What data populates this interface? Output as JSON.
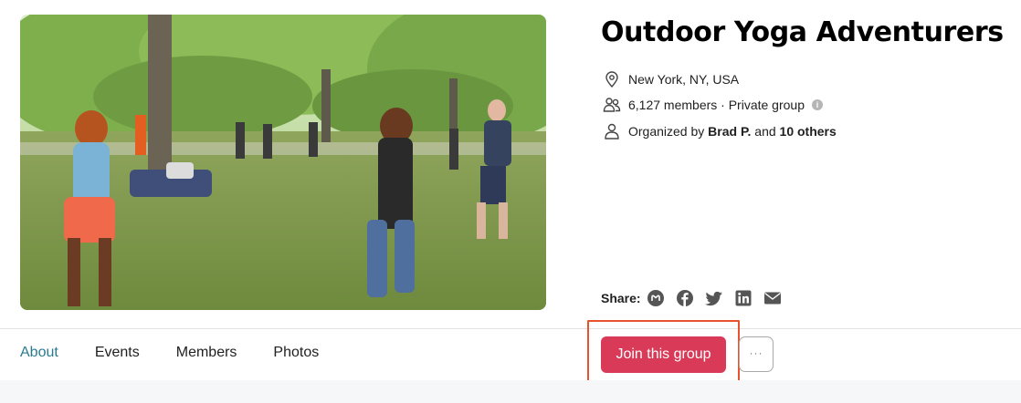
{
  "group": {
    "title": "Outdoor Yoga Adventurers",
    "location": "New York, NY, USA",
    "members_text": "6,127 members · Private group",
    "info_icon": "i",
    "organizer_prefix": "Organized by ",
    "organizer_name": "Brad P.",
    "organizer_mid": " and ",
    "organizer_others": "10 others"
  },
  "share": {
    "label": "Share:",
    "icons": [
      "meetup-icon",
      "facebook-icon",
      "twitter-icon",
      "linkedin-icon",
      "email-icon"
    ]
  },
  "tabs": [
    {
      "label": "About",
      "active": true
    },
    {
      "label": "Events",
      "active": false
    },
    {
      "label": "Members",
      "active": false
    },
    {
      "label": "Photos",
      "active": false
    }
  ],
  "actions": {
    "join_label": "Join this group",
    "more_label": "···"
  },
  "colors": {
    "brand_red": "#d83a58",
    "active_tab": "#2a7b8f",
    "highlight": "#e8532d"
  }
}
